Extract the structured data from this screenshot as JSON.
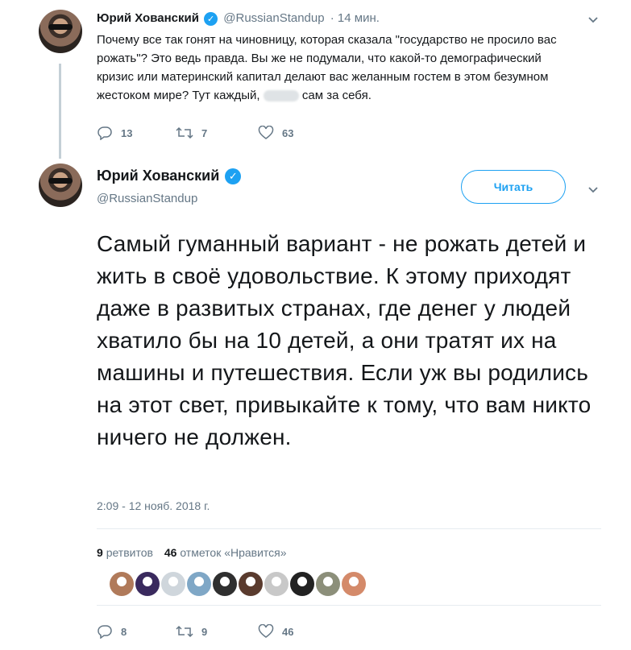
{
  "tweet1": {
    "name": "Юрий Хованский",
    "handle": "@RussianStandup",
    "time": "· 14 мин.",
    "text_before_blur": "Почему все так гонят на чиновницу, которая сказала \"государство не просило вас рожать\"? Это ведь правда. Вы же не подумали, что какой-то демографический кризис или материнский капитал делают вас желанным гостем в этом безумном жестоком мире? Тут каждый,",
    "text_after_blur": "сам за себя.",
    "replies": "13",
    "retweets": "7",
    "likes": "63"
  },
  "tweet2": {
    "name": "Юрий Хованский",
    "handle": "@RussianStandup",
    "follow_label": "Читать",
    "text": "Самый гуманный вариант - не рожать детей и жить в своё удовольствие. К этому приходят даже в развитых странах, где денег у людей хватило бы на 10 детей, а они тратят их на машины и путешествия. Если уж вы родились на этот свет, привыкайте к тому, что вам никто ничего не должен.",
    "timestamp": "2:09 - 12 нояб. 2018 г.",
    "retweet_count": "9",
    "retweet_label": "ретвитов",
    "like_count": "46",
    "like_label": "отметок «Нравится»",
    "replies": "8",
    "retweets": "9",
    "likes": "46"
  },
  "colors": {
    "accent": "#1da1f2",
    "muted": "#657786",
    "divider": "#e6ecf0"
  },
  "likers": [
    {
      "name": "liker-avatar-1",
      "color": "#b07a5a"
    },
    {
      "name": "liker-avatar-2",
      "color": "#3a2a5e"
    },
    {
      "name": "liker-avatar-3",
      "color": "#cfd6dc"
    },
    {
      "name": "liker-avatar-4",
      "color": "#7fa7c6"
    },
    {
      "name": "liker-avatar-5",
      "color": "#2f2f2f"
    },
    {
      "name": "liker-avatar-6",
      "color": "#5a3b2e"
    },
    {
      "name": "liker-avatar-7",
      "color": "#c8c8c8"
    },
    {
      "name": "liker-avatar-8",
      "color": "#222222"
    },
    {
      "name": "liker-avatar-9",
      "color": "#8c8f7a"
    },
    {
      "name": "liker-avatar-10",
      "color": "#d48a6a"
    }
  ]
}
